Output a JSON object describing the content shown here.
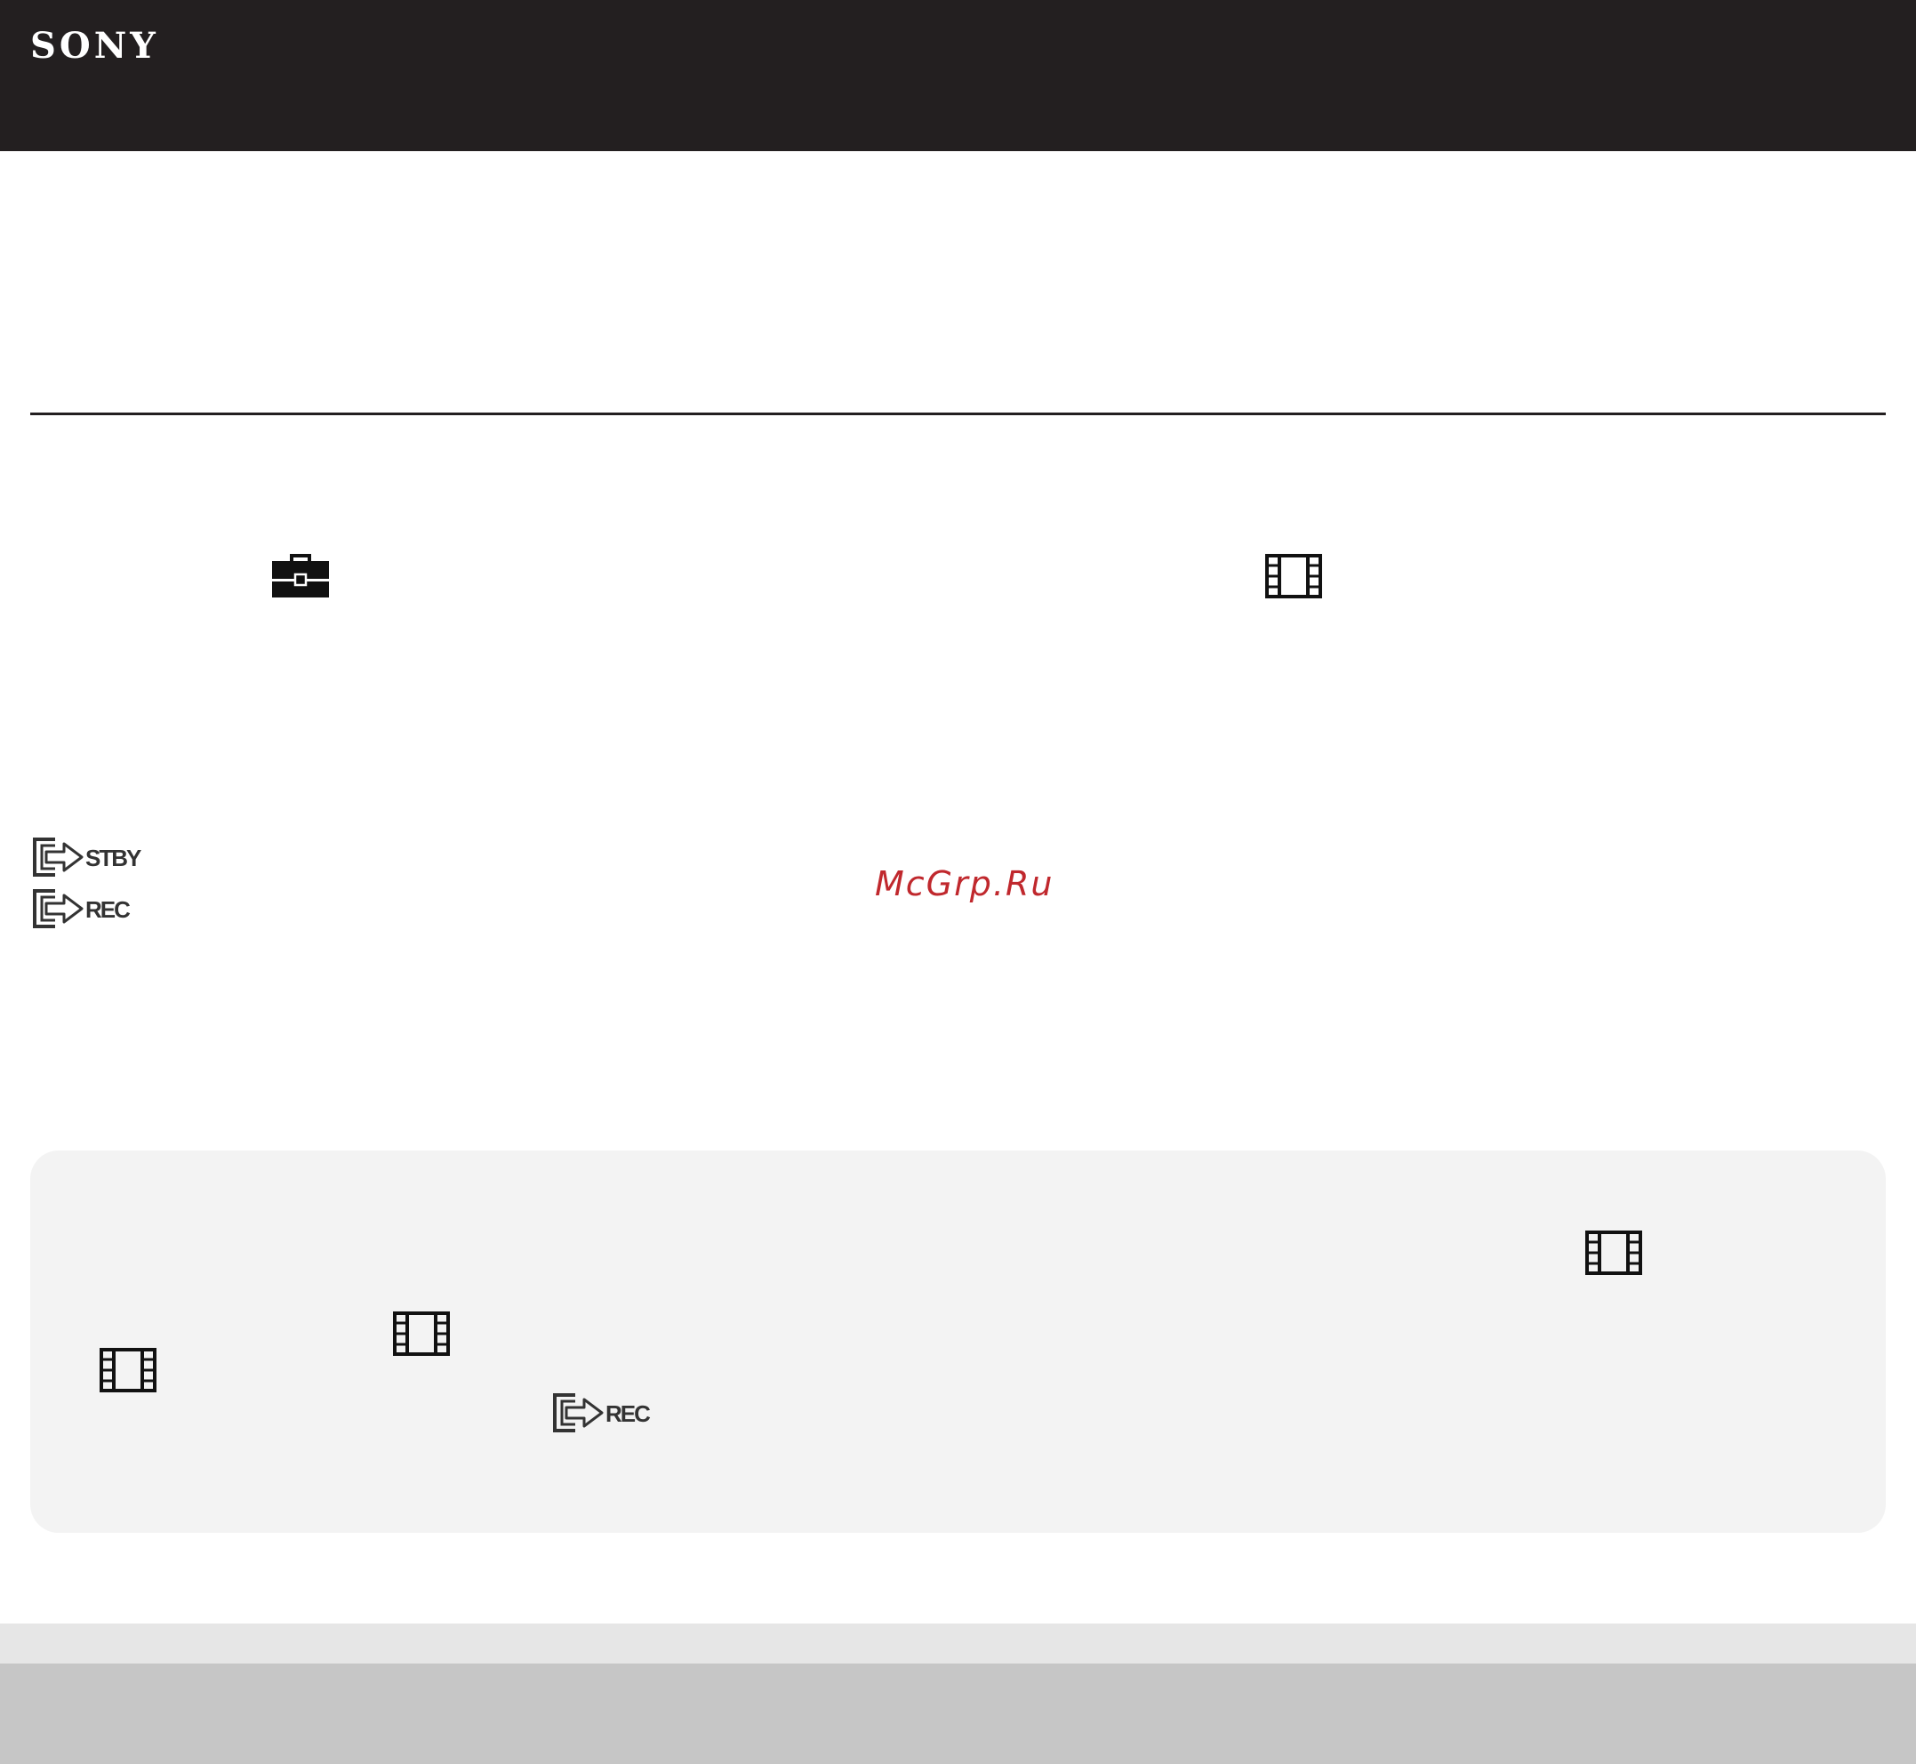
{
  "header": {
    "brand": "SONY",
    "background": "#231f20"
  },
  "watermark": {
    "text": "McGrp.Ru",
    "color": "#c0282d"
  },
  "icons": {
    "setup": "toolbox-icon",
    "movie": "movie-film-icon",
    "output_standby": "output-stby-icon",
    "output_record": "output-rec-icon"
  },
  "icon_labels": {
    "stby": "STBY",
    "rec": "REC"
  },
  "colors": {
    "note_background": "#f3f3f3",
    "footer_light": "#e6e6e6",
    "footer_dark": "#c6c6c6",
    "icon": "#111111"
  }
}
